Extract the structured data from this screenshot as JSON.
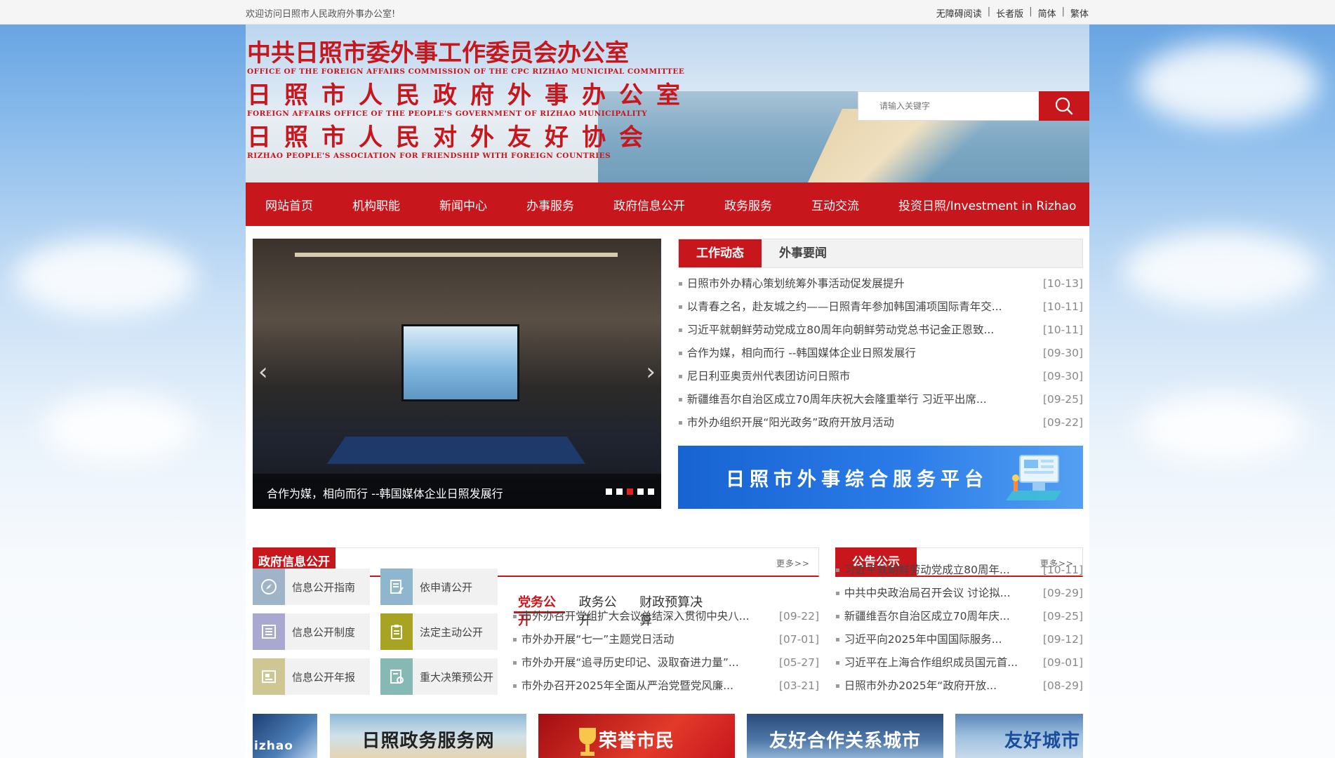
{
  "topbar": {
    "welcome": "欢迎访问日照市人民政府外事办公室!",
    "links": [
      "无障碍阅读",
      "长者版",
      "简体",
      "繁体"
    ]
  },
  "header": {
    "line1_cn": "中共日照市委外事工作委员会办公室",
    "line1_en": "OFFICE OF THE FOREIGN AFFAIRS COMMISSION OF THE CPC RIZHAO MUNICIPAL COMMITTEE",
    "line2_cn": "日照市人民政府外事办公室",
    "line2_en": "FOREIGN AFFAIRS OFFICE OF THE PEOPLE'S GOVERNMENT OF RIZHAO MUNICIPALITY",
    "line3_cn": "日照市人民对外友好协会",
    "line3_en": "RIZHAO PEOPLE'S ASSOCIATION FOR FRIENDSHIP WITH FOREIGN COUNTRIES",
    "search_placeholder": "请输入关键字"
  },
  "nav": [
    "网站首页",
    "机构职能",
    "新闻中心",
    "办事服务",
    "政府信息公开",
    "政务服务",
    "互动交流",
    "投资日照/Investment in Rizhao"
  ],
  "carousel": {
    "caption": "合作为媒，相向而行 --韩国媒体企业日照发展行",
    "dots": 5,
    "active_dot": 3
  },
  "news": {
    "tabs": [
      "工作动态",
      "外事要闻"
    ],
    "active_tab": 0,
    "items": [
      {
        "title": "日照市外办精心策划统筹外事活动促发展提升",
        "date": "[10-13]"
      },
      {
        "title": "以青春之名，赴友城之约——日照青年参加韩国浦项国际青年交...",
        "date": "[10-11]"
      },
      {
        "title": "习近平就朝鲜劳动党成立80周年向朝鲜劳动党总书记金正恩致...",
        "date": "[10-11]"
      },
      {
        "title": "合作为媒，相向而行 --韩国媒体企业日照发展行",
        "date": "[09-30]"
      },
      {
        "title": "尼日利亚奥贡州代表团访问日照市",
        "date": "[09-30]"
      },
      {
        "title": "新疆维吾尔自治区成立70周年庆祝大会隆重举行 习近平出席...",
        "date": "[09-25]"
      },
      {
        "title": "市外办组织开展“阳光政务”政府开放月活动",
        "date": "[09-22]"
      }
    ]
  },
  "service_banner": "日照市外事综合服务平台",
  "gov_info": {
    "title": "政府信息公开",
    "more": "更多>>",
    "tiles": [
      {
        "label": "信息公开指南",
        "icon": "compass-icon",
        "color": "#9fb4c9"
      },
      {
        "label": "依申请公开",
        "icon": "document-edit-icon",
        "color": "#8fb6cf"
      },
      {
        "label": "信息公开制度",
        "icon": "document-list-icon",
        "color": "#a9a8d0"
      },
      {
        "label": "法定主动公开",
        "icon": "clipboard-icon",
        "color": "#a9a324"
      },
      {
        "label": "信息公开年报",
        "icon": "report-icon",
        "color": "#cfc793"
      },
      {
        "label": "重大决策预公开",
        "icon": "decision-icon",
        "color": "#86b9b3"
      }
    ],
    "subtabs": [
      "党务公开",
      "政务公开",
      "财政预算决算"
    ],
    "active_subtab": 0,
    "items": [
      {
        "title": "市外办召开党组扩大会议总结深入贯彻中央八...",
        "date": "[09-22]"
      },
      {
        "title": "市外办开展“七一”主题党日活动",
        "date": "[07-01]"
      },
      {
        "title": "市外办开展“追寻历史印记、汲取奋进力量”...",
        "date": "[05-27]"
      },
      {
        "title": "市外办召开2025年全面从严治党暨党风廉...",
        "date": "[03-21]"
      }
    ]
  },
  "notice": {
    "title": "公告公示",
    "more": "更多>>",
    "items": [
      {
        "title": "习近平就朝鲜劳动党成立80周年...",
        "date": "[10-11]"
      },
      {
        "title": "中共中央政治局召开会议 讨论拟...",
        "date": "[09-29]"
      },
      {
        "title": "新疆维吾尔自治区成立70周年庆...",
        "date": "[09-25]"
      },
      {
        "title": "习近平向2025年中国国际服务...",
        "date": "[09-12]"
      },
      {
        "title": "习近平在上海合作组织成员国元首...",
        "date": "[09-01]"
      },
      {
        "title": "日照市外办2025年“政府开放...",
        "date": "[08-29]"
      }
    ]
  },
  "bottom_links": [
    {
      "label": "izhao"
    },
    {
      "label": "日照政务服务网"
    },
    {
      "label": "荣誉市民"
    },
    {
      "label": "友好合作关系城市"
    },
    {
      "label": "友好城市"
    }
  ],
  "colors": {
    "brand_red": "#c8161d",
    "platform_blue": "#1a67d6"
  }
}
